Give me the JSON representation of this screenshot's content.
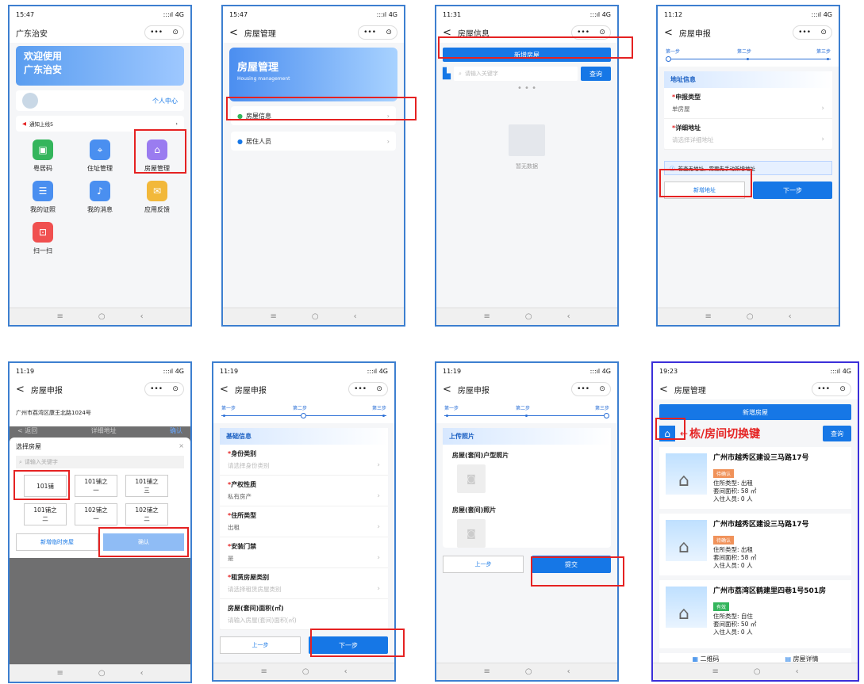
{
  "status": {
    "time1": "15:47",
    "time2": "15:47",
    "time3": "11:31",
    "time4": "11:12",
    "time5": "11:19",
    "time6": "11:19",
    "time7": "11:19",
    "time8": "19:23",
    "signal": ":::ıl 4G"
  },
  "p1": {
    "title": "广东治安",
    "banner1": "欢迎使用",
    "banner2": "广东治安",
    "user_center": "个人中心",
    "notice": "通知上线5",
    "grid": [
      "粤居码",
      "住址管理",
      "房屋管理",
      "我的证照",
      "我的消息",
      "应用反馈",
      "扫一扫"
    ]
  },
  "p2": {
    "title": "房屋管理",
    "banner": "房屋管理",
    "banner_en": "Housing management",
    "item1": "房屋信息",
    "item2": "居住人员"
  },
  "p3": {
    "title": "房屋信息",
    "add": "新增房屋",
    "search_ph": "请输入关键字",
    "search_btn": "查询",
    "empty": "暂无数据"
  },
  "p4": {
    "title": "房屋申报",
    "step1": "第一步",
    "step2": "第二步",
    "step3": "第三步",
    "section": "地址信息",
    "f1_label": "申报类型",
    "f1_value": "单房屋",
    "f2_label": "详细地址",
    "f2_value": "请选择详细地址",
    "notice": "若查无地址，需要先手动新增地址",
    "add_addr": "新增地址",
    "next": "下一步"
  },
  "p5": {
    "title": "房屋申报",
    "addr": "广州市荔湾区康王北路1024号",
    "back": "< 返回",
    "mid": "详细地址",
    "ok": "确认",
    "sheet_title": "选择房屋",
    "close": "×",
    "search_ph": "请输入关键字",
    "cells": [
      "101铺",
      "101铺之一",
      "101铺之三",
      "101铺之二",
      "102铺之一",
      "102铺之二"
    ],
    "temp": "新增临时房屋",
    "confirm": "确认"
  },
  "p6": {
    "title": "房屋申报",
    "step1": "第一步",
    "step2": "第二步",
    "step3": "第三步",
    "section": "基础信息",
    "fields": [
      {
        "label": "身份类别",
        "value": "请选择身份类别"
      },
      {
        "label": "产权性质",
        "value": "私有房产"
      },
      {
        "label": "住所类型",
        "value": "出租"
      },
      {
        "label": "安装门禁",
        "value": "是"
      },
      {
        "label": "租赁房屋类别",
        "value": "请选择租赁房屋类别"
      },
      {
        "label": "房屋(套间)面积(㎡)",
        "value": "请输入房屋(套间)面积(㎡)"
      }
    ],
    "prev": "上一步",
    "next": "下一步"
  },
  "p7": {
    "title": "房屋申报",
    "step1": "第一步",
    "step2": "第二步",
    "step3": "第三步",
    "section": "上传照片",
    "photo1": "房屋(套间)户型照片",
    "photo2": "房屋(套间)照片",
    "prev": "上一步",
    "submit": "提交"
  },
  "p8": {
    "title": "房屋管理",
    "add": "新增房屋",
    "switch_label": "栋/房间切换键",
    "search_btn": "查询",
    "cards": [
      {
        "title": "广州市越秀区建设三马路17号",
        "tag": "待确认",
        "type": "住所类型: 出租",
        "area": "套间面积: 58 ㎡",
        "people": "入住人员: 0 人"
      },
      {
        "title": "广州市越秀区建设三马路17号",
        "tag": "待确认",
        "type": "住所类型: 出租",
        "area": "套间面积: 58 ㎡",
        "people": "入住人员: 0 人"
      },
      {
        "title": "广州市荔湾区鹤建里四巷1号501房",
        "tag": "有效",
        "type": "住所类型: 自住",
        "area": "套间面积: 50 ㎡",
        "people": "入住人员: 0 人"
      }
    ],
    "qr": "二维码",
    "detail": "房屋详情"
  },
  "colors": {
    "primary": "#1677e6",
    "highlight": "#e52222",
    "tag_pending": "#f0925a",
    "tag_valid": "#34b55c"
  }
}
